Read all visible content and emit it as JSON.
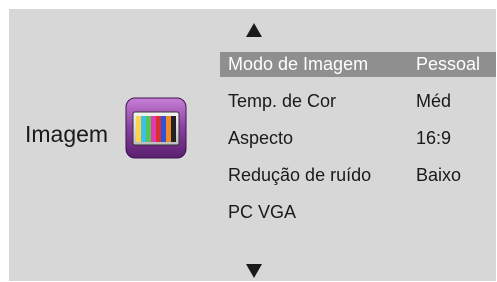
{
  "section": {
    "title": "Imagem",
    "icon": "color-bars-icon"
  },
  "nav": {
    "up_icon": "up-arrow-icon",
    "down_icon": "down-arrow-icon"
  },
  "menu": {
    "items": [
      {
        "label": "Modo de Imagem",
        "value": "Pessoal",
        "selected": true
      },
      {
        "label": "Temp. de Cor",
        "value": "Méd",
        "selected": false
      },
      {
        "label": "Aspecto",
        "value": "16:9",
        "selected": false
      },
      {
        "label": "Redução de ruído",
        "value": "Baixo",
        "selected": false
      },
      {
        "label": "PC VGA",
        "value": "",
        "selected": false
      }
    ]
  },
  "colors": {
    "panel_background": "#d7d7d7",
    "selected_row": "#8f8f8f",
    "icon_frame": "#7a3b8c"
  }
}
